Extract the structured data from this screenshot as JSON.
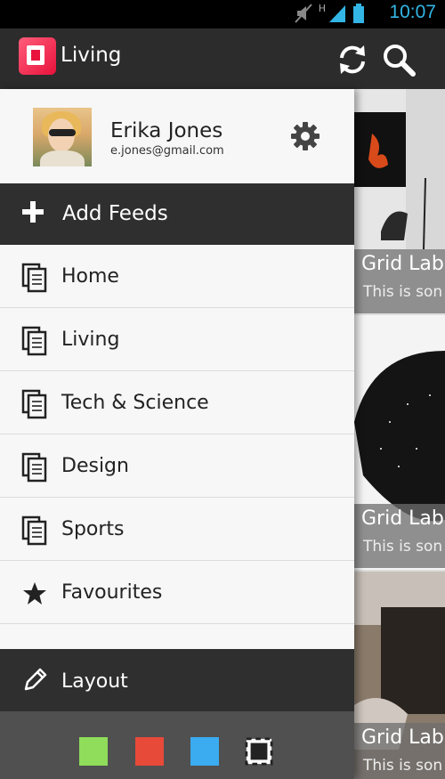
{
  "status_bar": {
    "time": "10:07",
    "network": "H",
    "icons": [
      "mute-icon",
      "signal-icon",
      "battery-icon"
    ]
  },
  "app_bar": {
    "title": "Living",
    "icons": [
      "refresh-icon",
      "search-icon"
    ],
    "logo_color": "#e8123c"
  },
  "profile": {
    "name": "Erika Jones",
    "email": "e.jones@gmail.com"
  },
  "drawer": {
    "add_feeds_label": "Add Feeds",
    "items": [
      {
        "label": "Home",
        "icon": "feed-icon"
      },
      {
        "label": "Living",
        "icon": "feed-icon"
      },
      {
        "label": "Tech & Science",
        "icon": "feed-icon"
      },
      {
        "label": "Design",
        "icon": "feed-icon"
      },
      {
        "label": "Sports",
        "icon": "feed-icon"
      },
      {
        "label": "Favourites",
        "icon": "star-icon"
      }
    ],
    "layout_label": "Layout",
    "swatches": [
      "#8fdd5a",
      "#e84a3a",
      "#3aacef",
      "#222222"
    ]
  },
  "cards": [
    {
      "title": "Grid Lab",
      "subtitle": "This is son"
    },
    {
      "title": "Grid Lab",
      "subtitle": "This is son"
    },
    {
      "title": "Grid Lab",
      "subtitle": "This is son"
    }
  ]
}
